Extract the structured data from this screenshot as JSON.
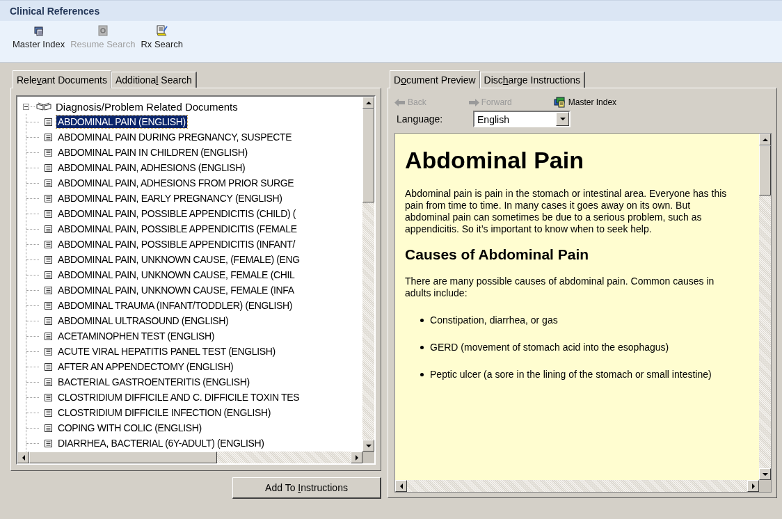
{
  "window": {
    "title": "Clinical References"
  },
  "toolbar": [
    {
      "label": "Master Index",
      "kind": "index",
      "disabled": false
    },
    {
      "label": "Resume Search",
      "kind": "resume",
      "disabled": true
    },
    {
      "label": "Rx Search",
      "kind": "rx",
      "disabled": false
    }
  ],
  "left_tabs": [
    {
      "label": [
        "Rele",
        "v",
        "ant Documents"
      ],
      "selected": true
    },
    {
      "label": [
        "Additiona",
        "l",
        " Search"
      ],
      "selected": false
    }
  ],
  "tree": {
    "label": "Diagnosis/Problem Related Documents",
    "expanded": true,
    "children": [
      {
        "label": "ABDOMINAL PAIN (ENGLISH)",
        "selected": true
      },
      {
        "label": "ABDOMINAL PAIN DURING PREGNANCY, SUSPECTE",
        "selected": false
      },
      {
        "label": "ABDOMINAL PAIN IN CHILDREN (ENGLISH)",
        "selected": false
      },
      {
        "label": "ABDOMINAL PAIN, ADHESIONS (ENGLISH)",
        "selected": false
      },
      {
        "label": "ABDOMINAL PAIN, ADHESIONS FROM PRIOR SURGE",
        "selected": false
      },
      {
        "label": "ABDOMINAL PAIN, EARLY PREGNANCY (ENGLISH)",
        "selected": false
      },
      {
        "label": "ABDOMINAL PAIN, POSSIBLE APPENDICITIS (CHILD) (",
        "selected": false
      },
      {
        "label": "ABDOMINAL PAIN, POSSIBLE APPENDICITIS (FEMALE",
        "selected": false
      },
      {
        "label": "ABDOMINAL PAIN, POSSIBLE APPENDICITIS (INFANT/",
        "selected": false
      },
      {
        "label": "ABDOMINAL PAIN, UNKNOWN CAUSE, (FEMALE) (ENG",
        "selected": false
      },
      {
        "label": "ABDOMINAL PAIN, UNKNOWN CAUSE, FEMALE (CHIL",
        "selected": false
      },
      {
        "label": "ABDOMINAL PAIN, UNKNOWN CAUSE, FEMALE (INFA",
        "selected": false
      },
      {
        "label": "ABDOMINAL TRAUMA (INFANT/TODDLER) (ENGLISH)",
        "selected": false
      },
      {
        "label": "ABDOMINAL ULTRASOUND (ENGLISH)",
        "selected": false
      },
      {
        "label": "ACETAMINOPHEN TEST (ENGLISH)",
        "selected": false
      },
      {
        "label": "ACUTE VIRAL HEPATITIS PANEL TEST (ENGLISH)",
        "selected": false
      },
      {
        "label": "AFTER AN APPENDECTOMY (ENGLISH)",
        "selected": false
      },
      {
        "label": "BACTERIAL GASTROENTERITIS (ENGLISH)",
        "selected": false
      },
      {
        "label": "CLOSTRIDIUM DIFFICILE AND C. DIFFICILE TOXIN TES",
        "selected": false
      },
      {
        "label": "CLOSTRIDIUM DIFFICILE INFECTION (ENGLISH)",
        "selected": false
      },
      {
        "label": "COPING WITH COLIC (ENGLISH)",
        "selected": false
      },
      {
        "label": "DIARRHEA, BACTERIAL (6Y-ADULT) (ENGLISH)",
        "selected": false
      }
    ]
  },
  "add_button": {
    "label": [
      "Add To ",
      "I",
      "nstructions"
    ]
  },
  "right_tabs": [
    {
      "label": [
        "D",
        "o",
        "cument Preview"
      ],
      "selected": true
    },
    {
      "label": [
        "Disc",
        "h",
        "arge Instructions"
      ],
      "selected": false
    }
  ],
  "nav": [
    {
      "label": "Back",
      "kind": "back",
      "disabled": true
    },
    {
      "label": "Forward",
      "kind": "forward",
      "disabled": true
    },
    {
      "label": "Master Index",
      "kind": "index",
      "disabled": false
    }
  ],
  "language": {
    "label": "Language:",
    "value": "English"
  },
  "document": [
    {
      "kind": "h1",
      "text": "Abdominal Pain"
    },
    {
      "kind": "p",
      "text": "Abdominal pain is pain in the stomach or intestinal area. Everyone has this pain from time to time. In many cases it goes away on its own. But abdominal pain can sometimes be due to a serious problem, such as appendicitis. So it’s important to know when to seek help."
    },
    {
      "kind": "h2",
      "text": "Causes of Abdominal Pain"
    },
    {
      "kind": "p",
      "text": "There are many possible causes of abdominal pain. Common causes in adults include:"
    },
    {
      "kind": "li",
      "text": "Constipation, diarrhea, or gas"
    },
    {
      "kind": "li",
      "text": "GERD (movement of stomach acid into the esophagus)"
    },
    {
      "kind": "li",
      "text": "Peptic ulcer (a sore in the lining of the stomach or small intestine)"
    }
  ]
}
